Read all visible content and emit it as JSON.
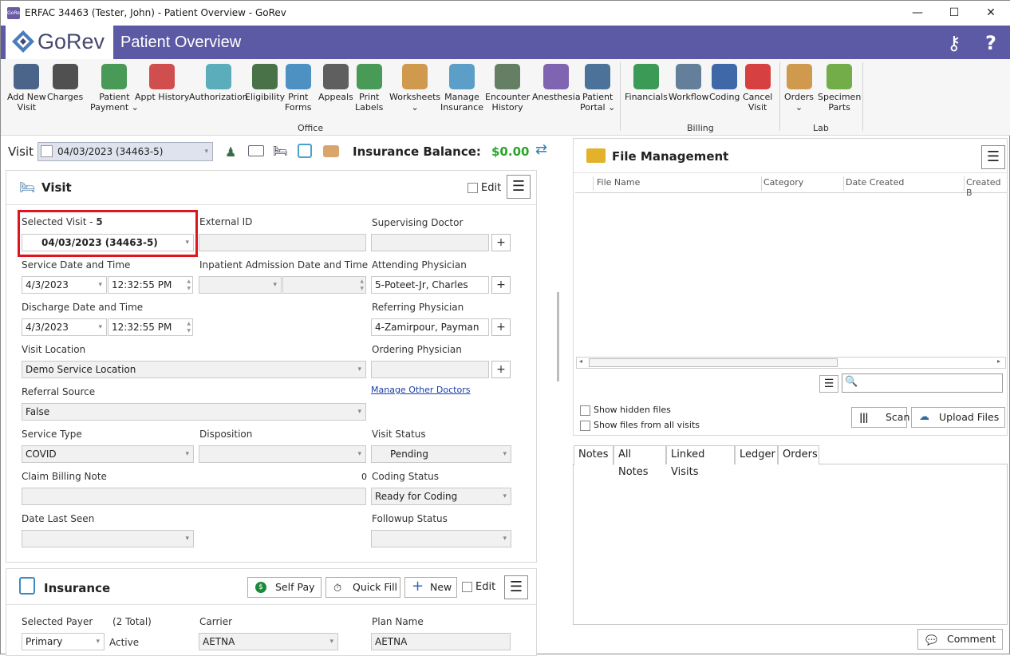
{
  "window": {
    "title": "ERFAC 34463 (Tester, John) - Patient Overview - GoRev",
    "app_icon_text": "GoRev"
  },
  "header": {
    "logo": "GoRev",
    "page_title": "Patient Overview"
  },
  "ribbon": {
    "office": [
      {
        "label": "Add New\nVisit"
      },
      {
        "label": "Charges"
      },
      {
        "label": "Patient\nPayment ⌄"
      },
      {
        "label": "Appt History"
      },
      {
        "label": "Authorization"
      },
      {
        "label": "Eligibility"
      },
      {
        "label": "Print\nForms"
      },
      {
        "label": "Appeals"
      },
      {
        "label": "Print\nLabels"
      },
      {
        "label": "Worksheets\n⌄"
      },
      {
        "label": "Manage\nInsurance"
      },
      {
        "label": "Encounter\nHistory"
      },
      {
        "label": "Anesthesia"
      },
      {
        "label": "Patient\nPortal ⌄"
      }
    ],
    "billing": [
      {
        "label": "Financials"
      },
      {
        "label": "Workflow"
      },
      {
        "label": "Coding"
      },
      {
        "label": "Cancel\nVisit"
      }
    ],
    "lab": [
      {
        "label": "Orders\n⌄"
      },
      {
        "label": "Specimen\nParts"
      }
    ],
    "groups": {
      "office": "Office",
      "billing": "Billing",
      "lab": "Lab"
    }
  },
  "visitbar": {
    "label": "Visit",
    "selected": "04/03/2023 (34463-5)",
    "ins_label": "Insurance Balance:",
    "ins_value": "$0.00"
  },
  "visit_panel": {
    "title": "Visit",
    "edit": "Edit",
    "selected_visit_label": "Selected Visit -",
    "selected_visit_num": "5",
    "selected_visit_value": "04/03/2023 (34463-5)",
    "external_id_label": "External ID",
    "supervising_label": "Supervising Doctor",
    "service_dt_label": "Service Date and Time",
    "service_date": "4/3/2023",
    "service_time": "12:32:55 PM",
    "inpatient_label": "Inpatient Admission Date and Time",
    "attending_label": "Attending Physician",
    "attending_value": "5-Poteet-Jr, Charles",
    "discharge_label": "Discharge Date and Time",
    "discharge_date": "4/3/2023",
    "discharge_time": "12:32:55 PM",
    "referring_label": "Referring Physician",
    "referring_value": "4-Zamirpour, Payman",
    "location_label": "Visit Location",
    "location_value": "Demo Service Location",
    "ordering_label": "Ordering Physician",
    "referral_label": "Referral Source",
    "referral_value": "False",
    "manage_doctors": "Manage Other Doctors",
    "service_type_label": "Service Type",
    "service_type_value": "COVID",
    "disposition_label": "Disposition",
    "visit_status_label": "Visit Status",
    "visit_status_value": "Pending",
    "claim_note_label": "Claim Billing Note",
    "claim_note_count": "0",
    "coding_status_label": "Coding Status",
    "coding_status_value": "Ready for Coding",
    "last_seen_label": "Date Last Seen",
    "followup_label": "Followup Status"
  },
  "insurance_panel": {
    "title": "Insurance",
    "self_pay": "Self Pay",
    "quick_fill": "Quick Fill",
    "new": "New",
    "edit": "Edit",
    "payer_label": "Selected Payer",
    "total": "(2 Total)",
    "payer_value": "Primary",
    "active": "Active",
    "carrier_label": "Carrier",
    "carrier_value": "AETNA",
    "plan_label": "Plan Name",
    "plan_value": "AETNA"
  },
  "file_mgmt": {
    "title": "File Management",
    "columns": [
      "File Name",
      "Category",
      "Date Created",
      "Created B"
    ],
    "show_hidden": "Show hidden files",
    "show_all": "Show files from all visits",
    "scan": "Scan",
    "upload": "Upload Files"
  },
  "notes": {
    "tabs": [
      "Notes",
      "All Notes",
      "Linked Visits",
      "Ledger",
      "Orders"
    ],
    "comment": "Comment"
  },
  "colors": {
    "header": "#5d5aa5",
    "balance": "#2aa52a",
    "highlight": "#e0141e"
  }
}
